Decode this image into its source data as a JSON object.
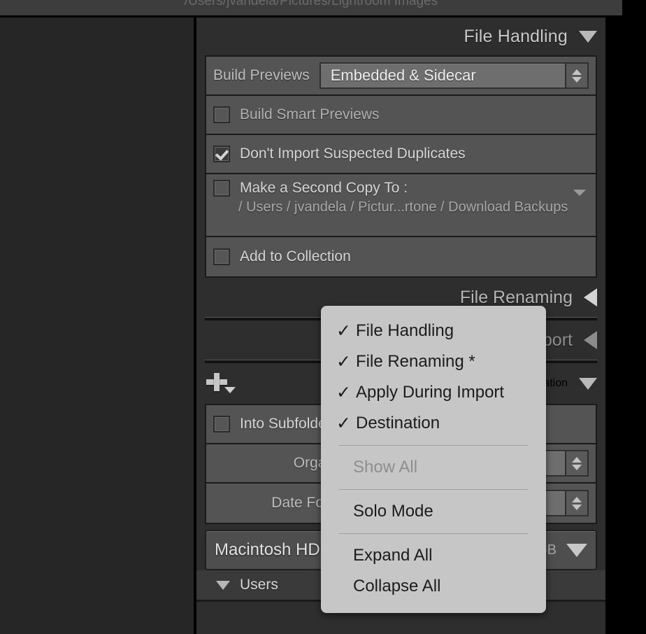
{
  "window": {
    "breadcrumb_path": "/Users/jvandela/Pictures/Lightroom Images"
  },
  "file_handling": {
    "title": "File Handling",
    "collapse_icon": "triangle-down-icon",
    "build_previews": {
      "label": "Build Previews",
      "value": "Embedded & Sidecar",
      "stepper_icon": "stepper-updown-icon"
    },
    "build_smart_previews": {
      "label": "Build Smart Previews",
      "checked": false
    },
    "dont_import_duplicates": {
      "label": "Don't Import Suspected Duplicates",
      "checked": true
    },
    "second_copy": {
      "label": "Make a Second Copy To :",
      "checked": false,
      "path": "/ Users / jvandela / Pictur...rtone / Download Backups",
      "menu_icon": "triangle-down-small-icon"
    },
    "add_to_collection": {
      "label": "Add to Collection",
      "checked": false
    }
  },
  "collapsed_panels": [
    {
      "title": "File Renaming",
      "visible_fragment": "ng",
      "icon": "triangle-left-icon"
    },
    {
      "title": "Apply During Import",
      "visible_fragment": "ort",
      "icon": "triangle-left-icon"
    }
  ],
  "destination": {
    "title": "Destination",
    "visible_fragment": "on",
    "collapse_icon": "triangle-down-icon",
    "add_icon": "plus-with-chevron-icon",
    "into_subfolder": {
      "label": "Into Subfolder",
      "visible_fragment": "Into Subfold",
      "checked": false
    },
    "organize": {
      "label": "Organize",
      "visible_fragment": "Organ",
      "stepper_icon": "stepper-updown-icon"
    },
    "date_format": {
      "label": "Date Format",
      "visible_fragment": "Date Form",
      "stepper_icon": "stepper-updown-icon"
    },
    "drive": {
      "name": "Macintosh HD",
      "visible_fragment": "Macintosh HD",
      "free_space": "GB",
      "dropdown_icon": "triangle-down-icon"
    },
    "tree": [
      {
        "label": "Users",
        "expand_icon": "triangle-down-icon"
      }
    ]
  },
  "context_menu": {
    "items": [
      {
        "label": "File Handling",
        "checked": true,
        "enabled": true
      },
      {
        "label": "File Renaming *",
        "checked": true,
        "enabled": true
      },
      {
        "label": "Apply During Import",
        "checked": true,
        "enabled": true
      },
      {
        "label": "Destination",
        "checked": true,
        "enabled": true
      },
      {
        "separator": true
      },
      {
        "label": "Show All",
        "checked": false,
        "enabled": false
      },
      {
        "separator": true
      },
      {
        "label": "Solo Mode",
        "checked": false,
        "enabled": true
      },
      {
        "separator": true
      },
      {
        "label": "Expand All",
        "checked": false,
        "enabled": true
      },
      {
        "label": "Collapse All",
        "checked": false,
        "enabled": true
      }
    ],
    "check_glyph": "✓"
  },
  "colors": {
    "panel_bg": "#2e2e2e",
    "row_bg": "#545454",
    "menu_bg": "#c6c6c6",
    "left_pane_bg": "#262626",
    "text_primary": "#d6d6d6"
  }
}
